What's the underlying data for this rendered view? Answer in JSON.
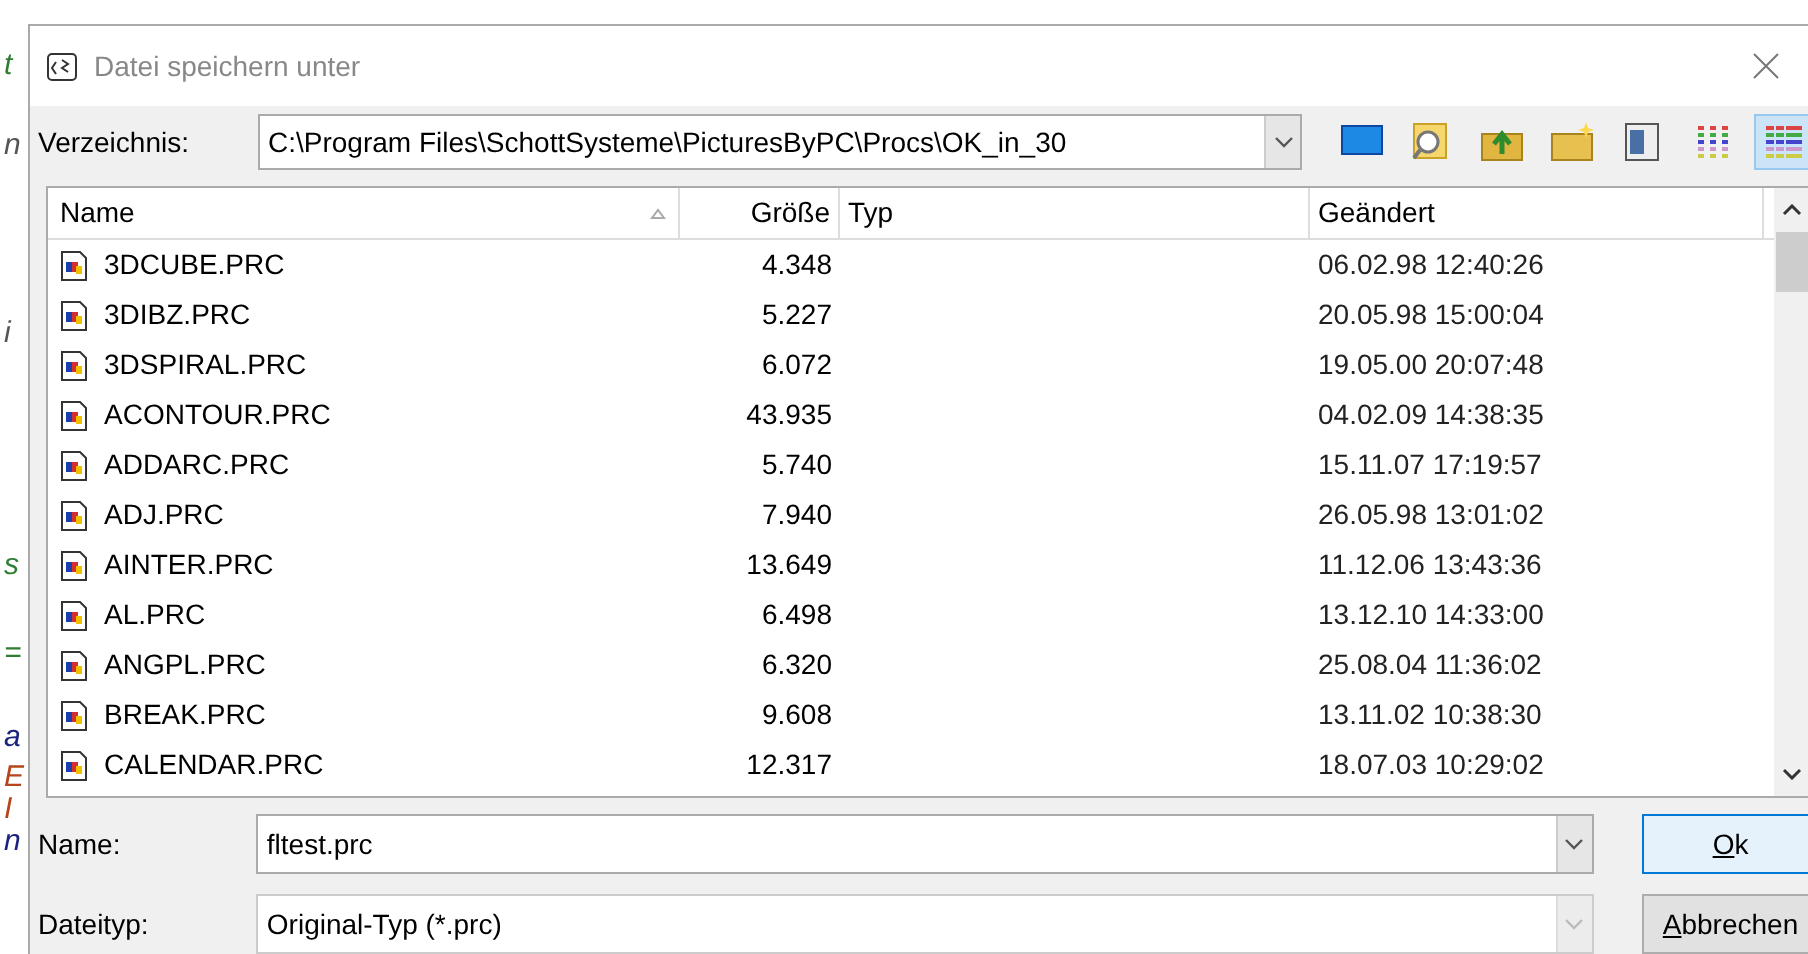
{
  "background_editor": [
    {
      "text": "t",
      "color": "#2e7d32"
    },
    {
      "text": "n",
      "color": "#555555"
    },
    {
      "text": "i",
      "color": "#555555"
    },
    {
      "text": "s",
      "color": "#2e7d32"
    },
    {
      "text": "=",
      "color": "#2e7d32"
    },
    {
      "text": "a",
      "color": "#1a237e"
    },
    {
      "text": "E",
      "color": "#b5451b"
    },
    {
      "text": "I",
      "color": "#b5451b"
    },
    {
      "text": "n",
      "color": "#1a237e"
    }
  ],
  "window": {
    "title": "Datei speichern unter"
  },
  "directory": {
    "label": "Verzeichnis:",
    "value": "C:\\Program Files\\SchottSysteme\\PicturesByPC\\Procs\\OK_in_30"
  },
  "toolbar": [
    {
      "kind": "desktop",
      "selected": false
    },
    {
      "kind": "search",
      "selected": false
    },
    {
      "kind": "up",
      "selected": false
    },
    {
      "kind": "newfolder",
      "selected": false
    },
    {
      "kind": "preview",
      "selected": false
    },
    {
      "kind": "list",
      "selected": false
    },
    {
      "kind": "details",
      "selected": true
    }
  ],
  "table": {
    "columns": [
      "Name",
      "Größe",
      "Typ",
      "Geändert"
    ],
    "rows": [
      {
        "name": "3DCUBE.PRC",
        "size": "4.348",
        "modified": "06.02.98 12:40:26"
      },
      {
        "name": "3DIBZ.PRC",
        "size": "5.227",
        "modified": "20.05.98 15:00:04"
      },
      {
        "name": "3DSPIRAL.PRC",
        "size": "6.072",
        "modified": "19.05.00 20:07:48"
      },
      {
        "name": "ACONTOUR.PRC",
        "size": "43.935",
        "modified": "04.02.09 14:38:35"
      },
      {
        "name": "ADDARC.PRC",
        "size": "5.740",
        "modified": "15.11.07 17:19:57"
      },
      {
        "name": "ADJ.PRC",
        "size": "7.940",
        "modified": "26.05.98 13:01:02"
      },
      {
        "name": "AINTER.PRC",
        "size": "13.649",
        "modified": "11.12.06 13:43:36"
      },
      {
        "name": "AL.PRC",
        "size": "6.498",
        "modified": "13.12.10 14:33:00"
      },
      {
        "name": "ANGPL.PRC",
        "size": "6.320",
        "modified": "25.08.04 11:36:02"
      },
      {
        "name": "BREAK.PRC",
        "size": "9.608",
        "modified": "13.11.02 10:38:30"
      },
      {
        "name": "CALENDAR.PRC",
        "size": "12.317",
        "modified": "18.07.03 10:29:02"
      }
    ]
  },
  "filename": {
    "label": "Name:",
    "value": "fltest.prc"
  },
  "filetype": {
    "label": "Dateityp:",
    "value": "Original-Typ (*.prc)",
    "disabled": true
  },
  "buttons": [
    {
      "accel": "O",
      "rest": "k",
      "default": true
    },
    {
      "accel": "A",
      "rest": "bbrechen",
      "default": false
    }
  ]
}
